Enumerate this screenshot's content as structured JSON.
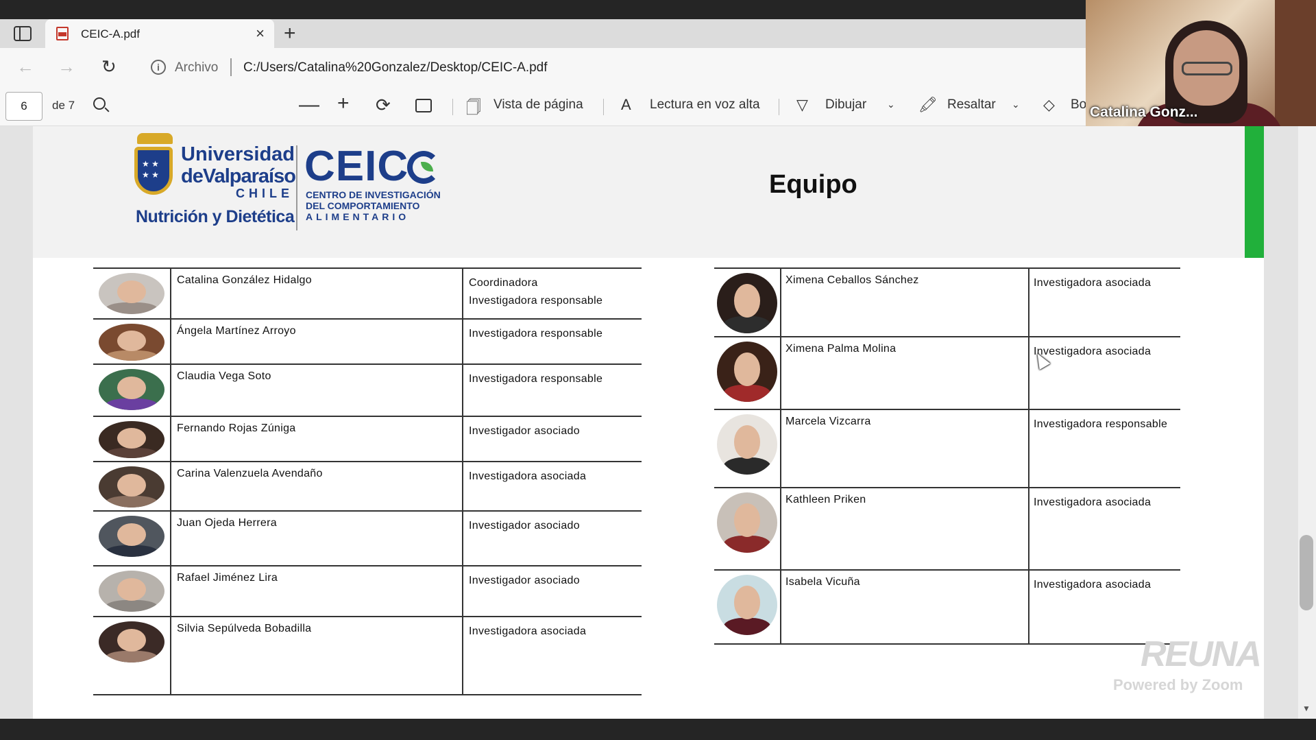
{
  "browser": {
    "tab_title": "CEIC-A.pdf",
    "tab_close": "×",
    "new_tab": "+",
    "nav_back": "←",
    "nav_forward": "→",
    "nav_reload": "↻",
    "info_icon": "i",
    "address_origin": "Archivo",
    "address_url": "C:/Users/Catalina%20Gonzalez/Desktop/CEIC-A.pdf"
  },
  "pdf_toolbar": {
    "page_number": "6",
    "page_total": "de 7",
    "zoom_out": "—",
    "zoom_in": "+",
    "rotate": "⟳",
    "page_view": "Vista de página",
    "read_aloud": "Lectura en voz alta",
    "draw": "Dibujar",
    "highlight": "Resaltar",
    "erase": "Bo",
    "page_view_icon": "🗍",
    "read_aloud_icon": "A",
    "draw_icon": "▽",
    "highlight_icon": "🖍",
    "erase_icon": "◇",
    "chevron": "⌄"
  },
  "video": {
    "participant_name": "Catalina Gonz..."
  },
  "document": {
    "logo": {
      "uv_line1": "Universidad",
      "uv_line2": "deValparaíso",
      "uv_country": "CHILE",
      "uv_faculty": "Nutrición y Dietética",
      "ceic_word": "CEIC",
      "ceic_sub1": "CENTRO DE INVESTIGACIÓN",
      "ceic_sub2": "DEL COMPORTAMIENTO",
      "ceic_sub3": "ALIMENTARIO"
    },
    "title": "Equipo",
    "left_team": [
      {
        "name": "Catalina González Hidalgo",
        "role": [
          "Coordinadora",
          "Investigadora responsable"
        ]
      },
      {
        "name": "Ángela Martínez Arroyo",
        "role": [
          "Investigadora responsable"
        ]
      },
      {
        "name": "Claudia Vega Soto",
        "role": [
          "Investigadora responsable"
        ]
      },
      {
        "name": "Fernando Rojas Zúniga",
        "role": [
          "Investigador asociado"
        ]
      },
      {
        "name": "Carina Valenzuela Avendaño",
        "role": [
          "Investigadora asociada"
        ]
      },
      {
        "name": "Juan Ojeda Herrera",
        "role": [
          "Investigador asociado"
        ]
      },
      {
        "name": "Rafael Jiménez Lira",
        "role": [
          "Investigador asociado"
        ]
      },
      {
        "name": "Silvia Sepúlveda Bobadilla",
        "role": [
          "Investigadora asociada"
        ]
      }
    ],
    "right_team": [
      {
        "name": "Ximena Ceballos Sánchez",
        "role": [
          "Investigadora asociada"
        ]
      },
      {
        "name": "Ximena Palma Molina",
        "role": [
          "Investigadora asociada"
        ]
      },
      {
        "name": "Marcela Vizcarra",
        "role": [
          "Investigadora responsable"
        ]
      },
      {
        "name": "Kathleen Priken",
        "role": [
          "Investigadora asociada"
        ]
      },
      {
        "name": "Isabela Vicuña",
        "role": [
          "Investigadora asociada"
        ]
      }
    ]
  },
  "watermark": {
    "brand": "REUNA",
    "powered": "Powered by Zoom"
  },
  "scroll_down_arrow": "▼",
  "colors": {
    "accent_green": "#21b03b",
    "brand_blue": "#1d3e8a"
  }
}
